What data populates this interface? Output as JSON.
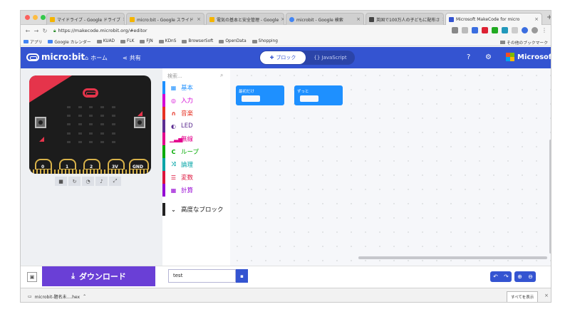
{
  "browser": {
    "tabs": [
      {
        "label": "マイドライブ - Google ドライブ",
        "color": "#f4b400",
        "active": false
      },
      {
        "label": "micro:bit - Google スライド",
        "color": "#f4b400",
        "active": false
      },
      {
        "label": "電気の基本と安全管理 - Google ",
        "color": "#f4b400",
        "active": false
      },
      {
        "label": "microbit - Google 検索",
        "color": "#4285f4",
        "active": false
      },
      {
        "label": "英国で100万人の子どもに配布さ",
        "color": "#444444",
        "active": false
      },
      {
        "label": "Microsoft MakeCode for micro",
        "color": "#3454d1",
        "active": true
      }
    ],
    "url": "https://makecode.microbit.org/#editor",
    "bookmarks": [
      "アプリ",
      "Google カレンダー",
      "KUAD",
      "FLK",
      "FJN",
      "KDnS",
      "BrowserSoft",
      "OpenData",
      "Shopping"
    ],
    "other_bookmarks": "その他のブックマーク"
  },
  "header": {
    "logo_text": "micro:bit",
    "home_label": "ホーム",
    "share_label": "共有",
    "blocks_label": "ブロック",
    "js_label": "{} JavaScript",
    "brand": "Microsoft",
    "accent_color": "#3454d1"
  },
  "simulator": {
    "pins": [
      "0",
      "1",
      "2",
      "3V",
      "GND"
    ]
  },
  "toolbox": {
    "search_placeholder": "検索...",
    "categories": [
      {
        "label": "基本",
        "color": "#1e90ff",
        "icon": "grid-icon"
      },
      {
        "label": "入力",
        "color": "#d400d4",
        "icon": "target-icon"
      },
      {
        "label": "音楽",
        "color": "#e63022",
        "icon": "headphones-icon"
      },
      {
        "label": "LED",
        "color": "#5c2d91",
        "icon": "toggle-icon"
      },
      {
        "label": "無線",
        "color": "#e3008c",
        "icon": "signal-icon"
      },
      {
        "label": "ループ",
        "color": "#00aa00",
        "icon": "refresh-icon"
      },
      {
        "label": "論理",
        "color": "#00a4a6",
        "icon": "shuffle-icon"
      },
      {
        "label": "変数",
        "color": "#dc143c",
        "icon": "list-icon"
      },
      {
        "label": "計算",
        "color": "#9400d3",
        "icon": "calculator-icon"
      }
    ],
    "advanced_label": "高度なブロック"
  },
  "workspace": {
    "blocks": [
      {
        "label": "最初だけ"
      },
      {
        "label": "ずっと"
      }
    ]
  },
  "footer": {
    "download_label": "ダウンロード",
    "project_name": "test"
  },
  "download_shelf": {
    "file_name": "microbit-題名未....hex",
    "show_all": "すべてを表示"
  }
}
